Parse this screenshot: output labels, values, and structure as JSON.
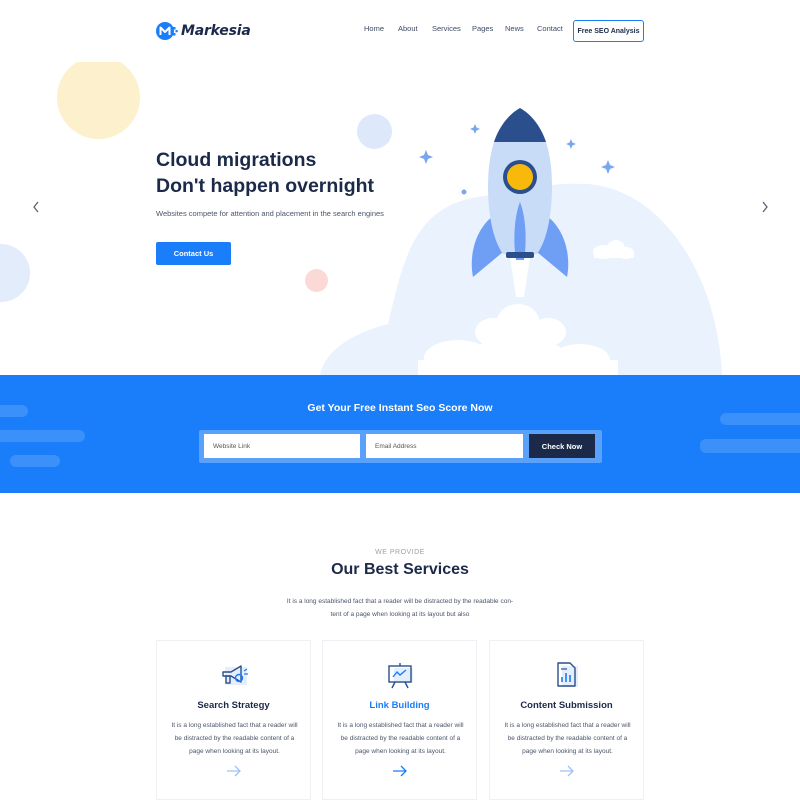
{
  "header": {
    "logo_text": "Markesia",
    "nav": [
      "Home",
      "About",
      "Services",
      "Pages",
      "News",
      "Contact"
    ],
    "cta_label": "Free SEO Analysis"
  },
  "hero": {
    "title_line1": "Cloud migrations",
    "title_line2": "Don't happen overnight",
    "subtitle": "Websites compete for attention and placement in the search engines",
    "button_label": "Contact Us"
  },
  "seo": {
    "title": "Get Your Free Instant Seo Score Now",
    "website_placeholder": "Website Link",
    "email_placeholder": "Email Address",
    "button_label": "Check Now"
  },
  "services": {
    "eyebrow": "WE PROVIDE",
    "title": "Our Best Services",
    "desc_line1": "It is a long established fact that a reader will be distracted by the readable con-",
    "desc_line2": "tent of a page when looking at its layout  but also",
    "cards": [
      {
        "title": "Search Strategy",
        "text_line1": "It is a long established fact that a reader will",
        "text_line2": "be distracted by the readable content of a",
        "text_line3": "page when looking at its layout."
      },
      {
        "title": "Link Building",
        "text_line1": "It is a long established fact that a reader will",
        "text_line2": "be distracted by the readable content of a",
        "text_line3": "page when looking at its layout."
      },
      {
        "title": "Content Submission",
        "text_line1": "It is a long established fact that a reader will",
        "text_line2": "be distracted by the readable content of a",
        "text_line3": "page when looking at its layout."
      }
    ]
  },
  "colors": {
    "primary": "#1a7dfa",
    "dark": "#1c2a4a",
    "hero_blob": "#eaf2fd",
    "yellow_circle": "#fdf0cc",
    "pink_circle": "#fad9d6",
    "rocket_body": "#c9dcf7",
    "rocket_accent": "#6f9ef5"
  },
  "icons": [
    "logo-m-icon",
    "chevron-left-icon",
    "chevron-right-icon",
    "rocket-icon",
    "sparkle-icon",
    "megaphone-icon",
    "presentation-chart-icon",
    "document-chart-icon",
    "arrow-right-icon"
  ]
}
